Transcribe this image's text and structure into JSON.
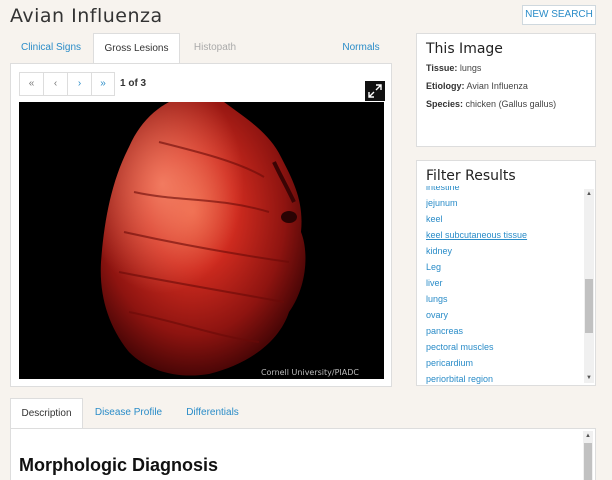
{
  "page": {
    "title": "Avian Influenza",
    "new_search_label": "NEW SEARCH"
  },
  "top_tabs": [
    {
      "label": "Clinical Signs",
      "state": "normal"
    },
    {
      "label": "Gross Lesions",
      "state": "active"
    },
    {
      "label": "Histopath",
      "state": "disabled"
    },
    {
      "label": "Normals",
      "state": "normal"
    }
  ],
  "pager": {
    "first": "«",
    "prev": "‹",
    "next": "›",
    "last": "»",
    "count_text": "1 of 3"
  },
  "image": {
    "credit": "Cornell University/PIADC"
  },
  "this_image": {
    "title": "This Image",
    "rows": [
      {
        "label": "Tissue:",
        "value": "lungs"
      },
      {
        "label": "Etiology:",
        "value": "Avian Influenza"
      },
      {
        "label": "Species:",
        "value": "chicken (Gallus gallus)"
      }
    ]
  },
  "filter": {
    "title": "Filter Results",
    "items": [
      "intestine",
      "jejunum",
      "keel",
      "keel subcutaneous tissue",
      "kidney",
      "Leg",
      "liver",
      "lungs",
      "ovary",
      "pancreas",
      "pectoral muscles",
      "pericardium",
      "periorbital region"
    ],
    "hovered_index": 3
  },
  "bottom_tabs": [
    {
      "label": "Description",
      "state": "active"
    },
    {
      "label": "Disease Profile",
      "state": "normal"
    },
    {
      "label": "Differentials",
      "state": "normal"
    }
  ],
  "description": {
    "heading": "Morphologic Diagnosis"
  },
  "colors": {
    "link": "#2a8cc8",
    "background": "#f7f3ee",
    "lung_red": "#c8241c"
  }
}
